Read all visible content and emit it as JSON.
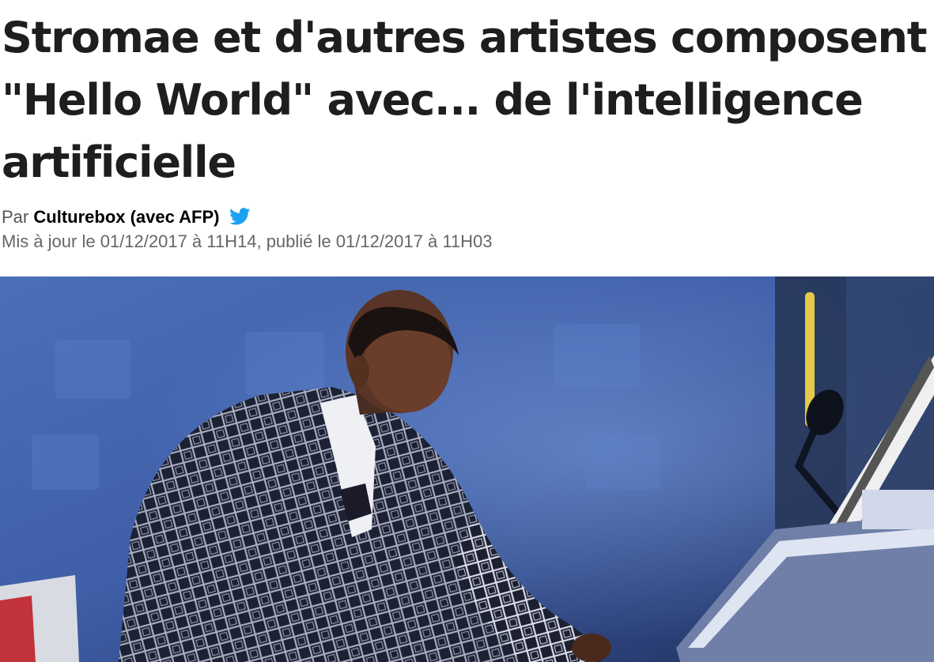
{
  "article": {
    "title": "Stromae et d'autres artistes composent \"Hello World\" avec... de l'intelligence artificielle",
    "byline": {
      "prefix": "Par",
      "author": "Culturebox (avec AFP)",
      "social_icon": "twitter-bird-icon"
    },
    "dateline": "Mis à jour le 01/12/2017 à 11H14, publié le 01/12/2017 à 11H03",
    "photo": {
      "subject": "stromae-at-keyboard-photo",
      "dominant_colors": [
        "#3f5fa8",
        "#1a2440",
        "#e8e4f0"
      ]
    }
  },
  "colors": {
    "title": "#1e1e1e",
    "author": "#000000",
    "meta": "#666666",
    "twitter": "#1da1f2"
  }
}
